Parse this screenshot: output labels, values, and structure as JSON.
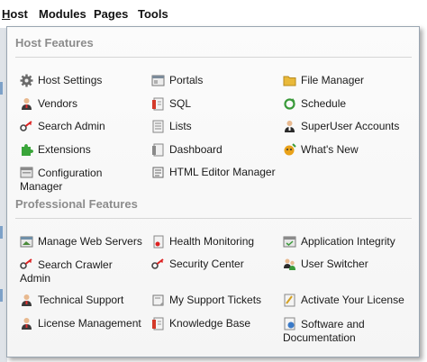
{
  "menubar": {
    "host_first": "H",
    "host_rest": "ost",
    "modules": "Modules",
    "pages": "Pages",
    "tools": "Tools"
  },
  "host_features": {
    "title": "Host Features",
    "col1": [
      {
        "label": "Host Settings",
        "icon": "gear-icon"
      },
      {
        "label": "Vendors",
        "icon": "vendor-person-icon"
      },
      {
        "label": "Search Admin",
        "icon": "search-key-icon"
      },
      {
        "label": "Extensions",
        "icon": "puzzle-piece-icon"
      },
      {
        "label": "Configuration Manager",
        "icon": "configuration-window-icon"
      }
    ],
    "col2": [
      {
        "label": "Portals",
        "icon": "portals-window-icon"
      },
      {
        "label": "SQL",
        "icon": "sql-document-icon"
      },
      {
        "label": "Lists",
        "icon": "lists-icon"
      },
      {
        "label": "Dashboard",
        "icon": "dashboard-document-icon"
      },
      {
        "label": "HTML Editor Manager",
        "icon": "html-editor-icon"
      }
    ],
    "col3": [
      {
        "label": "File Manager",
        "icon": "folder-icon"
      },
      {
        "label": "Schedule",
        "icon": "schedule-refresh-icon"
      },
      {
        "label": "SuperUser Accounts",
        "icon": "superuser-icon"
      },
      {
        "label": "What's New",
        "icon": "whats-new-icon"
      }
    ]
  },
  "professional_features": {
    "title": "Professional Features",
    "col1": [
      {
        "label": "Manage Web Servers",
        "icon": "web-servers-icon"
      },
      {
        "label": "Search Crawler Admin",
        "icon": "search-crawler-key-icon"
      },
      {
        "label": "Technical Support",
        "icon": "support-person-icon"
      },
      {
        "label": "License Management",
        "icon": "license-person-icon"
      }
    ],
    "col2": [
      {
        "label": "Health Monitoring",
        "icon": "health-monitor-icon"
      },
      {
        "label": "Security Center",
        "icon": "security-key-icon"
      },
      {
        "label": "My Support Tickets",
        "icon": "support-ticket-icon"
      },
      {
        "label": "Knowledge Base",
        "icon": "knowledge-base-icon"
      }
    ],
    "col3": [
      {
        "label": "Application Integrity",
        "icon": "integrity-window-icon"
      },
      {
        "label": "User Switcher",
        "icon": "user-switcher-icon"
      },
      {
        "label": "Activate Your License",
        "icon": "activate-license-icon"
      },
      {
        "label": "Software and Documentation",
        "icon": "software-docs-icon"
      }
    ]
  }
}
